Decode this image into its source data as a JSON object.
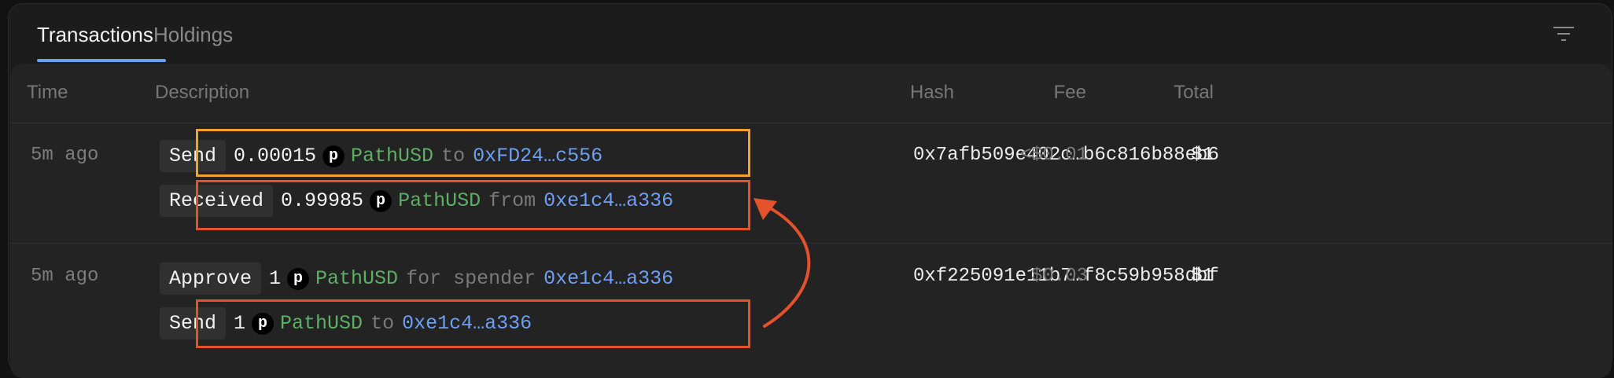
{
  "tabs": [
    {
      "label": "Transactions",
      "active": true
    },
    {
      "label": "Holdings",
      "active": false
    }
  ],
  "table": {
    "headers": {
      "time": "Time",
      "description": "Description",
      "hash": "Hash",
      "fee": "Fee",
      "total": "Total"
    },
    "rows": [
      {
        "time": "5m ago",
        "hash": "0x7afb509e402c…b6c816b88eb6",
        "fee": "<$0.01",
        "total": "$1",
        "lines": [
          {
            "action": "Send",
            "amount": "0.00015",
            "token_icon": "P",
            "token": "PathUSD",
            "preposition": "to",
            "address": "0xFD24…c556"
          },
          {
            "action": "Received",
            "amount": "0.99985",
            "token_icon": "P",
            "token": "PathUSD",
            "preposition": "from",
            "address": "0xe1c4…a336"
          }
        ]
      },
      {
        "time": "5m ago",
        "hash": "0xf225091e11b7…f8c59b958dbf",
        "fee": "$0.03",
        "total": "$1",
        "lines": [
          {
            "action": "Approve",
            "amount": "1",
            "token_icon": "P",
            "token": "PathUSD",
            "preposition": "for spender",
            "address": "0xe1c4…a336"
          },
          {
            "action": "Send",
            "amount": "1",
            "token_icon": "P",
            "token": "PathUSD",
            "preposition": "to",
            "address": "0xe1c4…a336"
          }
        ]
      }
    ]
  },
  "icons": {
    "filter": "filter-lines-icon",
    "token": "pathusd-token-icon",
    "arrow": "curved-arrow-icon"
  },
  "colors": {
    "accent_tab": "#6ea0f0",
    "token_green": "#5fae66",
    "address_blue": "#6f9ff2",
    "highlight_orange": "#f0a22a",
    "highlight_red": "#e4512a"
  }
}
